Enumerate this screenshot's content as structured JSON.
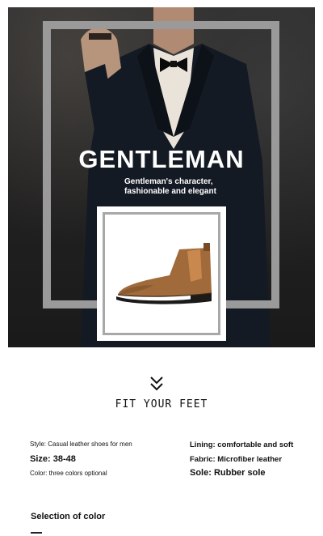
{
  "hero": {
    "title": "GENTLEMAN",
    "subtitle_line1": "Gentleman's character,",
    "subtitle_line2": "fashionable and elegant"
  },
  "section": {
    "fit_title": "FIT YOUR FEET"
  },
  "specs": {
    "style": "Style: Casual leather shoes for men",
    "size": "Size: 38-48",
    "color": "Color: three colors optional",
    "lining": "Lining: comfortable and soft",
    "fabric": "Fabric: Microfiber leather",
    "sole": "Sole: Rubber sole"
  },
  "color_section": {
    "title": "Selection of color"
  },
  "icons": {
    "chevron": "double-chevron-down-icon"
  }
}
